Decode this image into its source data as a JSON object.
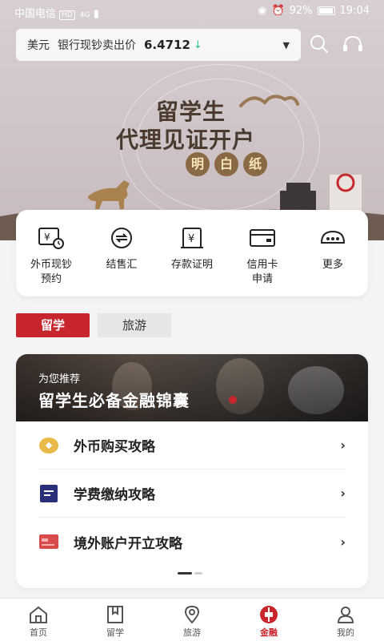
{
  "status_bar": {
    "carrier": "中国电信",
    "network_badge": "HD",
    "signal": "4G",
    "battery": "92%",
    "time": "19:04"
  },
  "rate_bar": {
    "currency": "美元",
    "label": "银行现钞卖出价",
    "rate": "6.4712",
    "trend_icon": "down-arrow-icon",
    "trend_color": "#2bbf8f"
  },
  "header_icons": [
    "search-icon",
    "headset-icon"
  ],
  "promo": {
    "line1": "留学生",
    "line2": "代理见证开户",
    "tags": [
      "明",
      "白",
      "纸"
    ]
  },
  "quick_actions": [
    {
      "id": "fx-cash",
      "icon": "currency-clock-icon",
      "label_line1": "外币现钞",
      "label_line2": "预约"
    },
    {
      "id": "fx-exchange",
      "icon": "exchange-icon",
      "label_line1": "结售汇",
      "label_line2": ""
    },
    {
      "id": "deposit-proof",
      "icon": "yen-document-icon",
      "label_line1": "存款证明",
      "label_line2": ""
    },
    {
      "id": "credit-card",
      "icon": "credit-card-icon",
      "label_line1": "信用卡",
      "label_line2": "申请"
    },
    {
      "id": "more",
      "icon": "more-icon",
      "label_line1": "更多",
      "label_line2": ""
    }
  ],
  "tabs": [
    {
      "label": "留学",
      "active": true
    },
    {
      "label": "旅游",
      "active": false
    }
  ],
  "recommend": {
    "kicker": "为您推荐",
    "headline": "留学生必备金融锦囊",
    "items": [
      {
        "icon": "gold-coin-icon",
        "label": "外币购买攻略"
      },
      {
        "icon": "tuition-card-icon",
        "label": "学费缴纳攻略"
      },
      {
        "icon": "bank-card-icon",
        "label": "境外账户开立攻略"
      }
    ]
  },
  "bottom_nav": [
    {
      "label": "首页",
      "icon": "home-icon",
      "active": false
    },
    {
      "label": "留学",
      "icon": "bookmark-icon",
      "active": false
    },
    {
      "label": "旅游",
      "icon": "location-pin-icon",
      "active": false
    },
    {
      "label": "金融",
      "icon": "boc-logo-icon",
      "active": true
    },
    {
      "label": "我的",
      "icon": "user-icon",
      "active": false
    }
  ],
  "colors": {
    "brand_red": "#c8262d",
    "banner_bg": "#d3c9cc",
    "promo_brown": "#4a3b2e",
    "tag_brown": "#8a6a44"
  }
}
